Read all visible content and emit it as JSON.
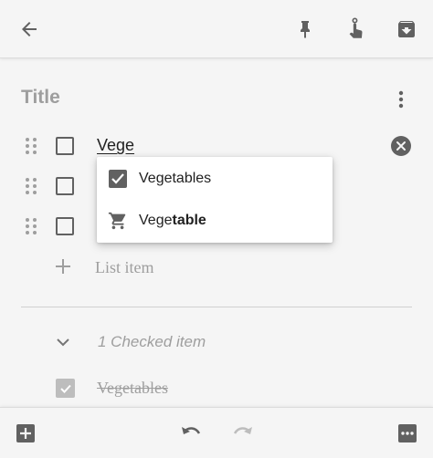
{
  "topbar": {
    "back_icon": "arrow-back-icon",
    "pin_icon": "pin-icon",
    "reminder_icon": "reminder-hand-icon",
    "archive_icon": "archive-icon"
  },
  "note": {
    "title_placeholder": "Title",
    "items": [
      {
        "text": "Vege",
        "checked": false
      },
      {
        "text": "",
        "checked": false
      },
      {
        "text": "",
        "checked": false
      }
    ],
    "add_item_label": "List item",
    "checked_header": "1 Checked item",
    "checked_items": [
      {
        "text": "Vegetables",
        "checked": true
      }
    ]
  },
  "suggestions": [
    {
      "icon": "checkbox-icon",
      "text": "Vegetables",
      "prefix": "",
      "bold": ""
    },
    {
      "icon": "shopping-cart-icon",
      "text": "Vegetable",
      "prefix": "Vege",
      "bold": "table"
    }
  ],
  "bottombar": {
    "add_icon": "add-box-icon",
    "undo_icon": "undo-icon",
    "redo_icon": "redo-icon",
    "more_icon": "more-horiz-icon"
  },
  "colors": {
    "background": "#f5f5f5",
    "icon": "#616161",
    "muted": "#9e9e9e"
  }
}
